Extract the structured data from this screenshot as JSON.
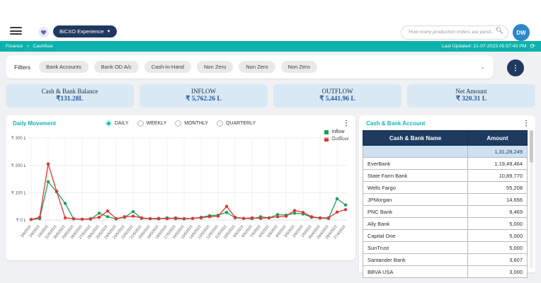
{
  "topbar": {
    "brand_button": "BiCXO Experience",
    "search_placeholder": "'How many production orders are pend...'",
    "avatar": "DW"
  },
  "breadcrumb": {
    "items": [
      "Finance",
      "Cashflow"
    ],
    "last_updated": "Last Updated: 21-07-2023 05:57:40 PM"
  },
  "filters": {
    "label": "Filters",
    "chips": [
      "Bank Accounts",
      "Bank OD A/c",
      "Cash-in-Hand",
      "Non Zero",
      "Non Zero",
      "Non Zero"
    ]
  },
  "kpis": [
    {
      "label": "Cash & Bank Balance",
      "value": "₹131.28L"
    },
    {
      "label": "INFLOW",
      "value": "₹ 5,762.26 L"
    },
    {
      "label": "OUTFLOW",
      "value": "₹ 5,441.96 L"
    },
    {
      "label": "Net Amount",
      "value": "₹ 320.31 L"
    }
  ],
  "chart": {
    "title": "Daily Movement",
    "intervals": [
      {
        "label": "DAILY",
        "selected": true
      },
      {
        "label": "WEEKLY",
        "selected": false
      },
      {
        "label": "MONTHLY",
        "selected": false
      },
      {
        "label": "QUARTERLY",
        "selected": false
      }
    ],
    "legend": [
      {
        "label": "Inflow",
        "color": "#17a258"
      },
      {
        "label": "Outflow",
        "color": "#e23333"
      }
    ]
  },
  "chart_data": {
    "type": "line",
    "title": "Daily Movement",
    "x": [
      "3/6/2023",
      "2/6/2023",
      "1/6/2023",
      "31/5/2023",
      "30/5/2023",
      "29/5/2023",
      "28/5/2023",
      "27/5/2023",
      "26/5/2023",
      "25/5/2023",
      "24/5/2023",
      "23/5/2023",
      "22/5/2023",
      "21/5/2023",
      "20/5/2023",
      "19/5/2023",
      "18/5/2023",
      "17/5/2023",
      "16/5/2023",
      "15/5/2023",
      "14/5/2023",
      "13/5/2023",
      "12/5/2023",
      "11/5/2023",
      "10/5/2023",
      "9/5/2023",
      "8/5/2023",
      "7/5/2023",
      "6/5/2023",
      "5/5/2023",
      "4/5/2023",
      "3/5/2023",
      "2/5/2023",
      "1/5/2023",
      "30/4/2023",
      "29/4/2023",
      "28/4/2023",
      "27/4/2023"
    ],
    "series": [
      {
        "name": "Inflow",
        "color": "#17a258",
        "values": [
          2,
          5,
          140,
          103,
          61,
          4,
          3,
          3,
          25,
          12,
          4,
          10,
          31,
          6,
          5,
          4,
          8,
          5,
          4,
          6,
          10,
          16,
          18,
          28,
          8,
          6,
          5,
          12,
          8,
          20,
          18,
          25,
          22,
          10,
          7,
          6,
          78,
          55
        ]
      },
      {
        "name": "Outflow",
        "color": "#e23333",
        "values": [
          2,
          10,
          205,
          105,
          8,
          5,
          3,
          5,
          10,
          33,
          5,
          12,
          14,
          8,
          5,
          6,
          5,
          8,
          5,
          6,
          8,
          12,
          14,
          50,
          10,
          6,
          8,
          6,
          8,
          12,
          14,
          35,
          28,
          12,
          8,
          8,
          29,
          38
        ]
      }
    ],
    "ylim": [
      0,
      300
    ],
    "ytick_values": [
      0,
      100,
      200,
      300
    ],
    "ytick_labels": [
      "₹ 0 L",
      "₹ 100 L",
      "₹ 200 L",
      "₹ 300 L"
    ],
    "grid": true,
    "legend_position": "top-right"
  },
  "account_table": {
    "title": "Cash & Bank Account",
    "columns": [
      "Cash & Bank Name",
      "Amount"
    ],
    "total_row": {
      "name": "",
      "amount": "1,31,28,249"
    },
    "rows": [
      {
        "name": "EverBank",
        "amount": "1,19,49,464"
      },
      {
        "name": "State Farm Bank",
        "amount": "10,89,770"
      },
      {
        "name": "Wells Fargo",
        "amount": "55,208"
      },
      {
        "name": "JPMorgan",
        "amount": "14,656"
      },
      {
        "name": "PNC Bank",
        "amount": "9,469"
      },
      {
        "name": "Ally Bank",
        "amount": "5,000"
      },
      {
        "name": "Capital One",
        "amount": "5,000"
      },
      {
        "name": "SunTrust",
        "amount": "5,000"
      },
      {
        "name": "Santander Bank",
        "amount": "3,607"
      },
      {
        "name": "BBVA USA",
        "amount": "3,000"
      }
    ]
  },
  "colors": {
    "teal": "#0cb2ab",
    "navy": "#1e3a5f",
    "kpi_bg": "#d9e8f5",
    "kpi_value": "#2457a0",
    "inflow": "#17a258",
    "outflow": "#e23333",
    "avatar_bg": "#2d87c9"
  }
}
